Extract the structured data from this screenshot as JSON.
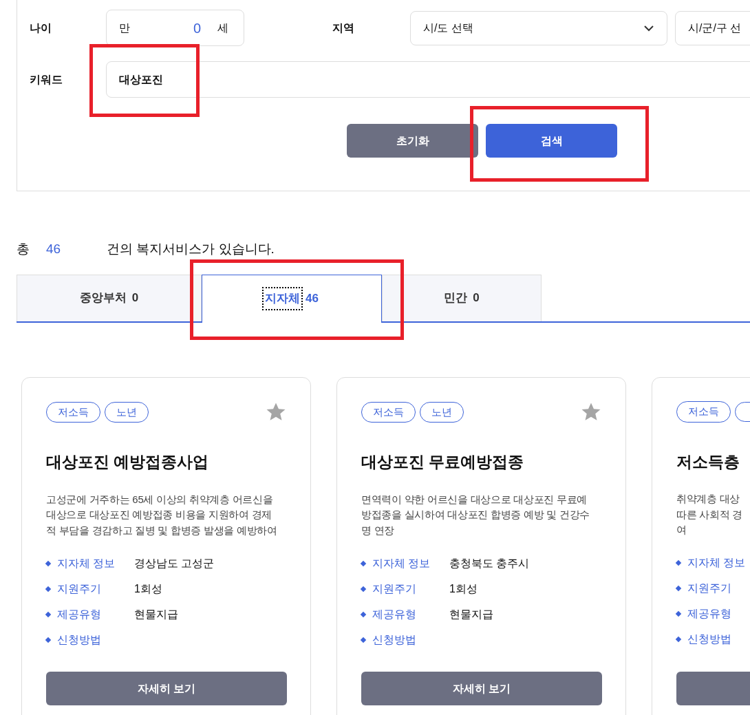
{
  "search_form": {
    "age": {
      "label": "나이",
      "prefix": "만",
      "value": "0",
      "suffix": "세"
    },
    "region": {
      "label": "지역",
      "selects": [
        "시/도 선택",
        "시/군/구 선"
      ]
    },
    "keyword": {
      "label": "키워드",
      "value": "대상포진",
      "highlighted": true
    },
    "buttons": [
      {
        "label": "초기화",
        "kind": "reset",
        "highlighted": false
      },
      {
        "label": "검색",
        "kind": "primary",
        "highlighted": true
      }
    ]
  },
  "result_summary": {
    "prefix": "총",
    "count": "46",
    "suffix": "건의 복지서비스가 있습니다."
  },
  "tabs": [
    {
      "label": "중앙부처",
      "count": "0",
      "selected": false,
      "focused": false,
      "highlighted": false
    },
    {
      "label": "지자체",
      "count": "46",
      "selected": true,
      "focused": true,
      "highlighted": true
    },
    {
      "label": "민간",
      "count": "0",
      "selected": false,
      "focused": false,
      "highlighted": false
    }
  ],
  "cards": [
    {
      "tags": [
        "저소득",
        "노년"
      ],
      "favorite": false,
      "title": "대상포진 예방접종사업",
      "description_lines": [
        "고성군에 거주하는 65세 이상의 취약계층 어르신을",
        "대상으로 대상포진 예방접종 비용을 지원하여 경제",
        "적 부담을 경감하고 질병 및 합병증 발생을 예방하여"
      ],
      "details": [
        {
          "label": "지자체 정보",
          "value": "경상남도 고성군"
        },
        {
          "label": "지원주기",
          "value": "1회성"
        },
        {
          "label": "제공유형",
          "value": "현물지급"
        },
        {
          "label": "신청방법"
        }
      ],
      "button": "자세히 보기"
    },
    {
      "tags": [
        "저소득",
        "노년"
      ],
      "favorite": false,
      "title": "대상포진 무료예방접종",
      "description_lines": [
        "면역력이 약한 어르신을 대상으로 대상포진 무료예",
        "방접종을 실시하여 대상포진 합병증 예방 및 건강수",
        "명 연장"
      ],
      "details": [
        {
          "label": "지자체 정보",
          "value": "충청북도 충주시"
        },
        {
          "label": "지원주기",
          "value": "1회성"
        },
        {
          "label": "제공유형",
          "value": "현물지급"
        },
        {
          "label": "신청방법"
        }
      ],
      "button": "자세히 보기"
    },
    {
      "tags": [
        "저소득"
      ],
      "title": "저소득층",
      "description_lines": [
        "취약계층 대상",
        "따른 사회적 경",
        "여"
      ],
      "details": [
        {
          "label": "지자체 정보"
        },
        {
          "label": "지원주기"
        },
        {
          "label": "제공유형"
        },
        {
          "label": "신청방법"
        }
      ]
    }
  ]
}
